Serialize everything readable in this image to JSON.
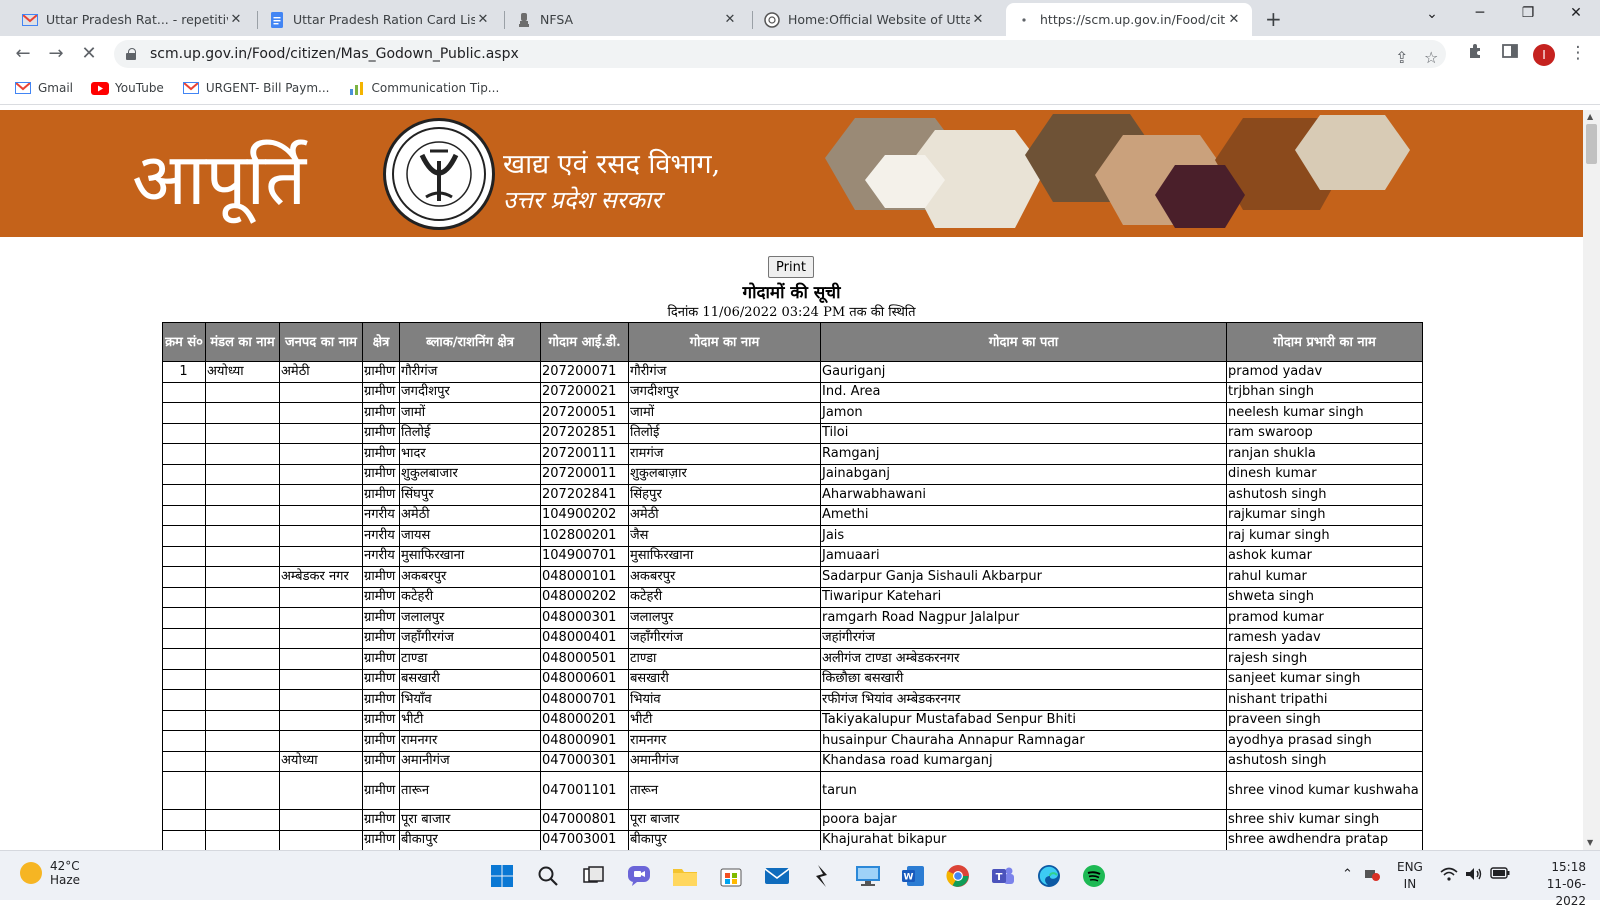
{
  "browser": {
    "tabs": [
      {
        "title": "Uttar Pradesh Rat... - repetitive -",
        "icon": "gmail-icon",
        "active": false
      },
      {
        "title": "Uttar Pradesh Ration Card List - C",
        "icon": "docs-icon",
        "active": false
      },
      {
        "title": "NFSA",
        "icon": "emblem-icon",
        "active": false
      },
      {
        "title": "Home:Official Website of Uttar P",
        "icon": "seal-icon",
        "active": false
      },
      {
        "title": "https://scm.up.gov.in/Food/citize",
        "icon": "loading-icon",
        "active": true
      }
    ],
    "url": "scm.up.gov.in/Food/citizen/Mas_Godown_Public.aspx",
    "avatar_letter": "I",
    "bookmarks": [
      {
        "label": "Gmail",
        "icon": "gmail-icon"
      },
      {
        "label": "YouTube",
        "icon": "youtube-icon"
      },
      {
        "label": "URGENT- Bill Paym...",
        "icon": "gmail-icon"
      },
      {
        "label": "Communication Tip...",
        "icon": "chart-icon"
      }
    ]
  },
  "banner": {
    "brand": "आपूर्ति",
    "dept_line1": "खाद्य एवं रसद विभाग,",
    "dept_line2": "उत्तर प्रदेश सरकार",
    "color": "#c4621a"
  },
  "page": {
    "print_label": "Print",
    "title": "गोदामों की सूची",
    "date_line": "दिनांक 11/06/2022 03:24 PM तक की स्थिति"
  },
  "table": {
    "headers": [
      "क्रम सं०",
      "मंडल का नाम",
      "जनपद का नाम",
      "क्षेत्र",
      "ब्लाक/राशनिंग क्षेत्र",
      "गोदाम आई.डी.",
      "गोदाम का नाम",
      "गोदाम का पता",
      "गोदाम प्रभारी का नाम"
    ],
    "rows": [
      [
        "1",
        "अयोध्या",
        "अमेठी",
        "ग्रामीण",
        "गौरीगंज",
        "207200071",
        "गौरीगंज",
        "Gauriganj",
        "pramod yadav"
      ],
      [
        "",
        "",
        "",
        "ग्रामीण",
        "जगदीशपुर",
        "207200021",
        "जगदीशपुर",
        "Ind. Area",
        "trjbhan singh"
      ],
      [
        "",
        "",
        "",
        "ग्रामीण",
        "जामों",
        "207200051",
        "जामों",
        "Jamon",
        "neelesh kumar singh"
      ],
      [
        "",
        "",
        "",
        "ग्रामीण",
        "तिलोई",
        "207202851",
        "तिलोई",
        "Tiloi",
        "ram swaroop"
      ],
      [
        "",
        "",
        "",
        "ग्रामीण",
        "भादर",
        "207200111",
        "रामगंज",
        "Ramganj",
        "ranjan shukla"
      ],
      [
        "",
        "",
        "",
        "ग्रामीण",
        "शुकुलबाजार",
        "207200011",
        "शुकुलबाज़ार",
        "Jainabganj",
        "dinesh kumar"
      ],
      [
        "",
        "",
        "",
        "ग्रामीण",
        "सिंघपुर",
        "207202841",
        "सिंहपुर",
        "Aharwabhawani",
        "ashutosh singh"
      ],
      [
        "",
        "",
        "",
        "नगरीय",
        "अमेठी",
        "104900202",
        "अमेठी",
        "Amethi",
        "rajkumar singh"
      ],
      [
        "",
        "",
        "",
        "नगरीय",
        "जायस",
        "102800201",
        "जैस",
        "Jais",
        "raj kumar singh"
      ],
      [
        "",
        "",
        "",
        "नगरीय",
        "मुसाफिरखाना",
        "104900701",
        "मुसाफिरखाना",
        "Jamuaari",
        "ashok kumar"
      ],
      [
        "",
        "",
        "अम्बेडकर नगर",
        "ग्रामीण",
        "अकबरपुर",
        "048000101",
        "अकबरपुर",
        "Sadarpur Ganja Sishauli Akbarpur",
        "rahul kumar"
      ],
      [
        "",
        "",
        "",
        "ग्रामीण",
        "कटेहरी",
        "048000202",
        "कटेहरी",
        "Tiwaripur Katehari",
        "shweta singh"
      ],
      [
        "",
        "",
        "",
        "ग्रामीण",
        "जलालपुर",
        "048000301",
        "जलालपुर",
        "ramgarh Road Nagpur Jalalpur",
        "pramod kumar"
      ],
      [
        "",
        "",
        "",
        "ग्रामीण",
        "जहाँगीरगंज",
        "048000401",
        "जहाँगीरगंज",
        "जहांगीरगंज",
        "ramesh yadav"
      ],
      [
        "",
        "",
        "",
        "ग्रामीण",
        "टाण्डा",
        "048000501",
        "टाण्डा",
        "अलीगंज टाण्डा अम्बेडकरनगर",
        "rajesh singh"
      ],
      [
        "",
        "",
        "",
        "ग्रामीण",
        "बसखारी",
        "048000601",
        "बसखारी",
        "किछौछा बसखारी",
        "sanjeet kumar singh"
      ],
      [
        "",
        "",
        "",
        "ग्रामीण",
        "भियाँव",
        "048000701",
        "भियांव",
        "रफीगंज भियांव अम्बेडकरनगर",
        "nishant tripathi"
      ],
      [
        "",
        "",
        "",
        "ग्रामीण",
        "भीटी",
        "048000201",
        "भीटी",
        "Takiyakalupur Mustafabad Senpur Bhiti",
        "praveen singh"
      ],
      [
        "",
        "",
        "",
        "ग्रामीण",
        "रामनगर",
        "048000901",
        "रामनगर",
        "husainpur Chauraha Annapur Ramnagar",
        "ayodhya prasad singh"
      ],
      [
        "",
        "",
        "अयोध्या",
        "ग्रामीण",
        "अमानीगंज",
        "047000301",
        "अमानीगंज",
        "Khandasa road kumarganj",
        "ashutosh singh"
      ],
      [
        "",
        "",
        "",
        "ग्रामीण",
        "तारून",
        "047001101",
        "तारून",
        "tarun",
        "shree vinod kumar kushwaha"
      ],
      [
        "",
        "",
        "",
        "ग्रामीण",
        "पूरा बाजार",
        "047000801",
        "पूरा बाजार",
        "poora bajar",
        "shree shiv kumar singh"
      ],
      [
        "",
        "",
        "",
        "ग्रामीण",
        "बीकापुर",
        "047003001",
        "बीकापुर",
        "Khajurahat bikapur",
        "shree awdhendra pratap"
      ]
    ]
  },
  "taskbar": {
    "temperature": "42°C",
    "condition": "Haze",
    "lang_line1": "ENG",
    "lang_line2": "IN",
    "time": "15:18",
    "date": "11-06-2022"
  }
}
